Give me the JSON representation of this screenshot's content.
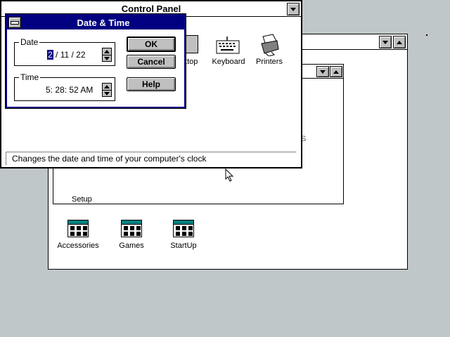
{
  "program_manager": {
    "groups": [
      {
        "label": "Accessories"
      },
      {
        "label": "Games"
      },
      {
        "label": "StartUp"
      }
    ],
    "main_group_fragment": "Setup"
  },
  "control_panel": {
    "title": "Control Panel",
    "icons": [
      {
        "label": "ktop"
      },
      {
        "label": "Keyboard"
      },
      {
        "label": "Printers"
      }
    ],
    "status_text": "Changes the date and time of your computer's clock",
    "hidden_fragment": "S"
  },
  "date_time_dialog": {
    "title": "Date & Time",
    "date_group_label": "Date",
    "date_month": "2",
    "date_rest": " / 11 / 22",
    "time_group_label": "Time",
    "time_value": "5: 28: 52 AM",
    "ok_label": "OK",
    "cancel_label": "Cancel",
    "help_label": "Help"
  },
  "colors": {
    "desktop": "#c0c7c8",
    "dialog_title": "#000080",
    "selection": "#000080"
  }
}
